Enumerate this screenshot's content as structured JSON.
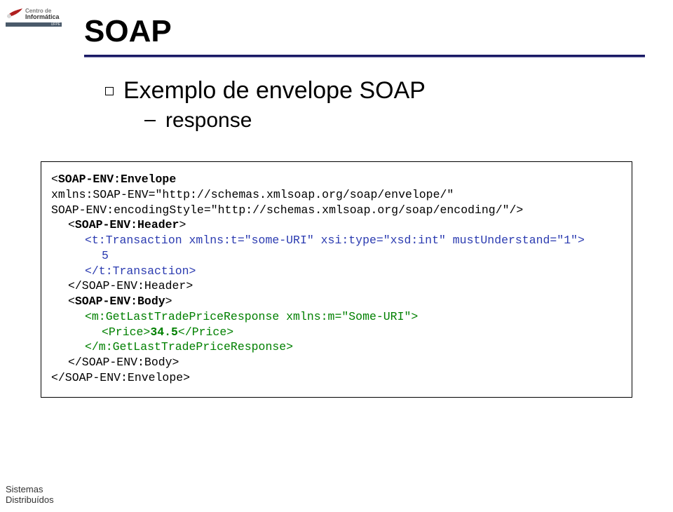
{
  "logo": {
    "centro": "Centro de",
    "inform": "Informática",
    "bar": "UFPE"
  },
  "title": "SOAP",
  "bullets": {
    "level1": "Exemplo de envelope SOAP",
    "level2": "response"
  },
  "code": {
    "l0a": "<",
    "l0b": "SOAP-ENV:Envelope",
    "l1": "xmlns:SOAP-ENV=\"http://schemas.xmlsoap.org/soap/envelope/\"",
    "l2": "SOAP-ENV:encodingStyle=\"http://schemas.xmlsoap.org/soap/encoding/\"/>",
    "l3a": "<",
    "l3b": "SOAP-ENV:Header",
    "l3c": ">",
    "l4": "<t:Transaction xmlns:t=\"some-URI\" xsi:type=\"xsd:int\" mustUnderstand=\"1\">",
    "l5": "5",
    "l6": "</t:Transaction>",
    "l7": "</SOAP-ENV:Header>",
    "l8a": "<",
    "l8b": "SOAP-ENV:Body",
    "l8c": ">",
    "l9": "<m:GetLastTradePriceResponse xmlns:m=\"Some-URI\">",
    "l10a": "<Price>",
    "l10b": "34.5",
    "l10c": "</Price>",
    "l11": "</m:GetLastTradePriceResponse>",
    "l12": "</SOAP-ENV:Body>",
    "l13": "</SOAP-ENV:Envelope>"
  },
  "footer": {
    "line1": "Sistemas",
    "line2": "Distribuídos"
  }
}
